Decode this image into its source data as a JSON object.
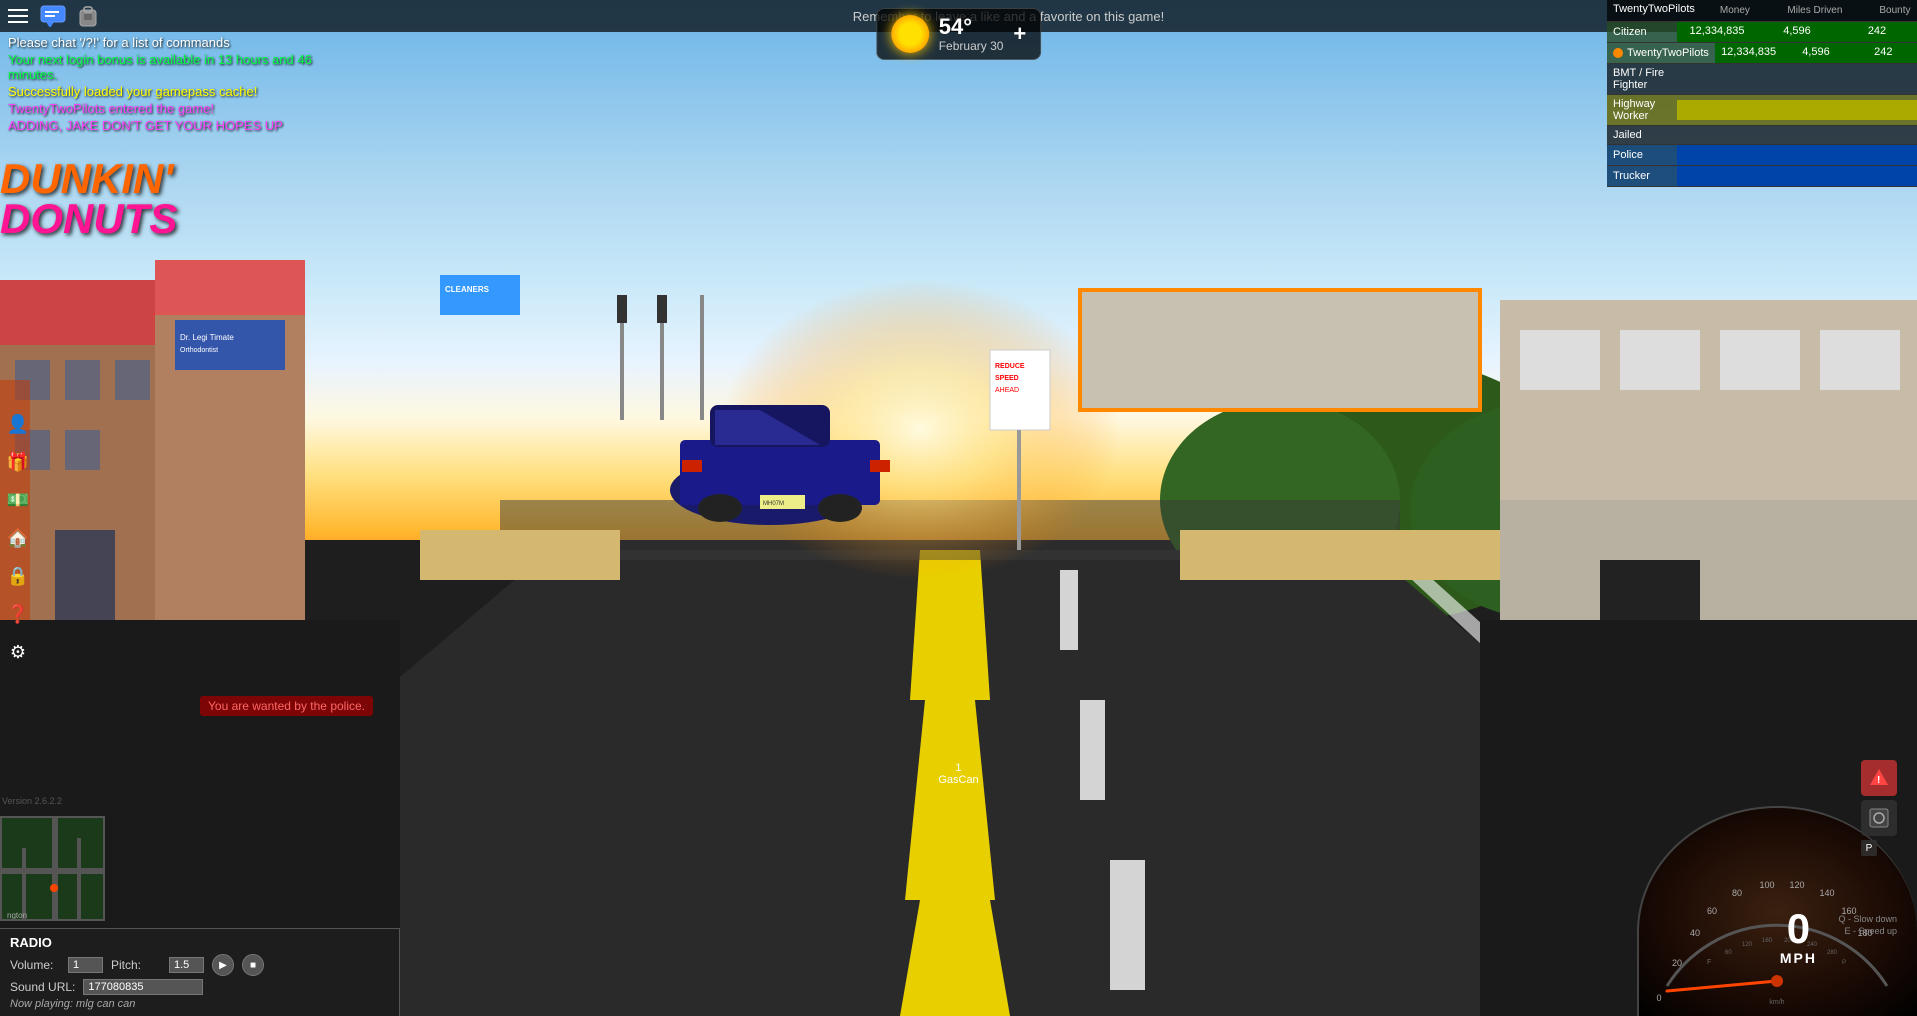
{
  "topbar": {
    "notice": "Remember to leave a like and a favorite on this game!"
  },
  "weather": {
    "temp": "54°",
    "date": "February 30",
    "plus_label": "+"
  },
  "leaderboard": {
    "player_name": "TwentyTwoPilots",
    "columns": [
      "Money",
      "Miles Driven",
      "Bounty"
    ],
    "rows": [
      {
        "name": "Citizen",
        "money": "12,334,835",
        "miles": "4,596",
        "bounty": "242",
        "highlight": "green"
      },
      {
        "name": "TwentyTwoPilots",
        "money": "12,334,835",
        "miles": "4,596",
        "bounty": "242",
        "highlight": "green",
        "dot": "orange"
      },
      {
        "name": "BMT / Fire Fighter",
        "money": "",
        "miles": "",
        "bounty": "",
        "highlight": "none"
      },
      {
        "name": "Highway Worker",
        "money": "",
        "miles": "",
        "bounty": "",
        "highlight": "yellow"
      },
      {
        "name": "Jailed",
        "money": "",
        "miles": "",
        "bounty": "",
        "highlight": "none"
      },
      {
        "name": "Police",
        "money": "",
        "miles": "",
        "bounty": "",
        "highlight": "blue"
      },
      {
        "name": "Trucker",
        "money": "",
        "miles": "",
        "bounty": "",
        "highlight": "blue"
      }
    ]
  },
  "chat": {
    "messages": [
      {
        "text": "Please chat '/?!' for a list of commands",
        "color": "white"
      },
      {
        "text": "Your next login bonus is available in 13 hours and 46 minutes.",
        "color": "green"
      },
      {
        "text": "Successfully loaded your gamepass cache!",
        "color": "yellow"
      },
      {
        "text": "TwentyTwoPilots entered the game!",
        "color": "pink"
      },
      {
        "text": "ADDING, JAKE DON'T GET YOUR HOPES UP",
        "color": "pink"
      }
    ]
  },
  "sidebar": {
    "icons": [
      {
        "name": "person-icon",
        "symbol": "👤"
      },
      {
        "name": "gift-icon",
        "symbol": "🎁"
      },
      {
        "name": "money-icon",
        "symbol": "💵"
      },
      {
        "name": "home-icon",
        "symbol": "🏠"
      },
      {
        "name": "lock-icon",
        "symbol": "🔒"
      },
      {
        "name": "help-icon",
        "symbol": "❓"
      },
      {
        "name": "settings-icon",
        "symbol": "⚙"
      }
    ]
  },
  "speedometer": {
    "speed": "0",
    "unit": "MPH",
    "hint_line1": "Q - Slow down",
    "hint_line2": "E - Speed up"
  },
  "radio": {
    "title": "RADIO",
    "volume_label": "Volume:",
    "volume_value": "1",
    "pitch_label": "Pitch:",
    "pitch_value": "1.5",
    "sound_url_label": "Sound URL:",
    "sound_url_value": "177080835",
    "now_playing_label": "Now playing:",
    "now_playing_value": "mlg can can"
  },
  "hud": {
    "version": "Version 2.6.2.2",
    "wanted_text": "You are wanted by the police.",
    "item_label": "GasCan",
    "item_count": "1",
    "minimap_location": "ngton"
  },
  "dunkin": {
    "line1": "DUNKIN'",
    "line2": "DONUTS"
  }
}
